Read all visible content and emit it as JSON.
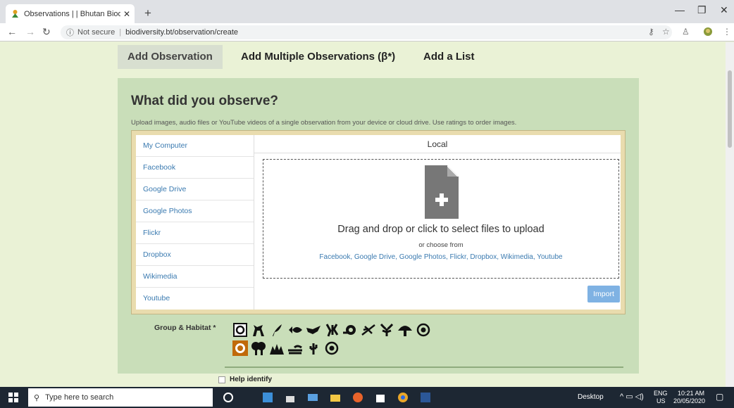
{
  "browser": {
    "tab_title": "Observations | | Bhutan Biodivers",
    "security": "Not secure",
    "url": "biodiversity.bt/observation/create"
  },
  "tabs": [
    {
      "label": "Add Observation",
      "active": true
    },
    {
      "label": "Add Multiple Observations (β*)",
      "active": false
    },
    {
      "label": "Add a List",
      "active": false
    }
  ],
  "panel": {
    "title": "What did you observe?",
    "subtitle": "Upload images, audio files or YouTube videos of a single observation from your device or cloud drive. Use ratings to order images."
  },
  "upload": {
    "sources": [
      "My Computer",
      "Facebook",
      "Google Drive",
      "Google Photos",
      "Flickr",
      "Dropbox",
      "Wikimedia",
      "Youtube"
    ],
    "local_header": "Local",
    "drop_text": "Drag and drop or click to select files to upload",
    "or_text": "or choose from",
    "links_text": "Facebook, Google Drive, Google Photos, Flickr, Dropbox, Wikimedia, Youtube",
    "import_label": "Import"
  },
  "group_habitat": {
    "label": "Group & Habitat *",
    "groups": [
      "all-icon",
      "mammal-icon",
      "plant-icon",
      "fish-icon",
      "bird-icon",
      "insect-icon",
      "mollusc-icon",
      "dragonfly-icon",
      "arthropod-icon",
      "fungi-icon",
      "other-icon"
    ],
    "habitats": [
      "all-habitat-icon",
      "forest-icon",
      "grassland-icon",
      "wetland-icon",
      "desert-icon",
      "other-habitat-icon"
    ]
  },
  "help_identify": "Help identify",
  "taskbar": {
    "search_placeholder": "Type here to search",
    "desktop": "Desktop",
    "lang1": "ENG",
    "lang2": "US",
    "time": "10:21 AM",
    "date": "20/05/2020"
  },
  "colors": {
    "page_bg": "#eaf2d6",
    "panel_bg": "#c9deb9",
    "link": "#3a7ab0",
    "import_button": "#7fb2e3"
  }
}
